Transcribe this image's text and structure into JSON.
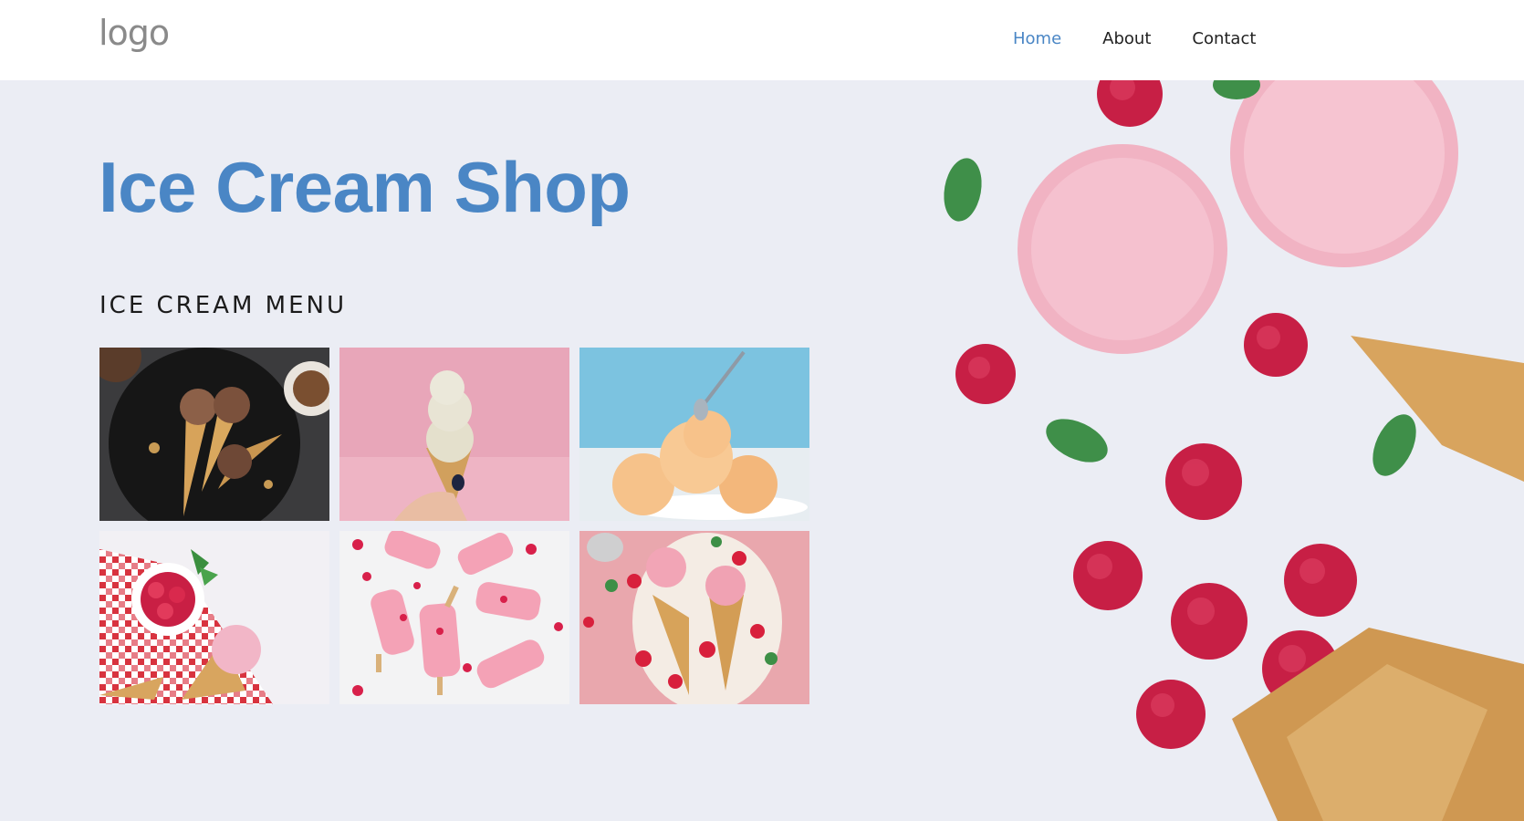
{
  "header": {
    "logo": "logo",
    "nav": [
      {
        "label": "Home",
        "active": true
      },
      {
        "label": "About",
        "active": false
      },
      {
        "label": "Contact",
        "active": false
      }
    ]
  },
  "hero": {
    "title": "Ice Cream Shop",
    "menu_heading": "ICE CREAM MENU",
    "menu_images": [
      {
        "name": "chocolate-cones-photo"
      },
      {
        "name": "vanilla-cone-pink-photo"
      },
      {
        "name": "peach-scoops-photo"
      },
      {
        "name": "raspberry-cone-checkered-photo"
      },
      {
        "name": "raspberry-popsicles-photo"
      },
      {
        "name": "strawberry-cones-photo"
      }
    ]
  },
  "colors": {
    "accent": "#4a86c5",
    "hero_bg": "#ebedf4",
    "text": "#1b1b1b"
  }
}
